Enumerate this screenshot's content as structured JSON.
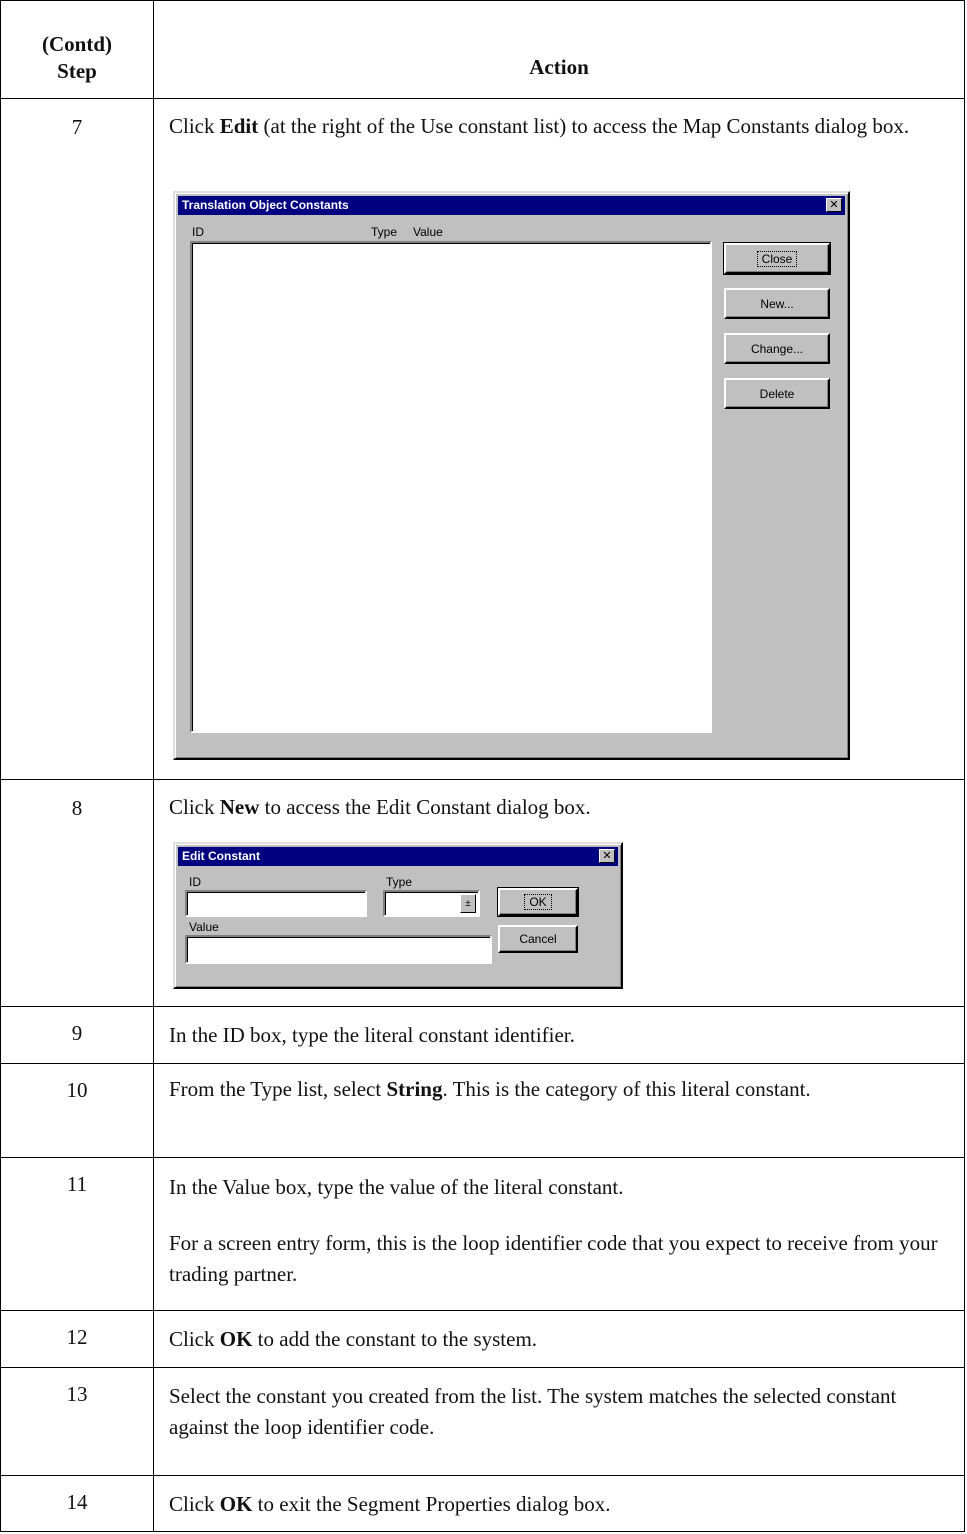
{
  "header": {
    "step_line1": "(Contd)",
    "step_line2": "Step",
    "action": "Action"
  },
  "steps": [
    {
      "num": "7",
      "pre": "Click ",
      "bold": "Edit",
      "post": " (at the right of the Use constant list) to access the Map Constants dialog box."
    },
    {
      "num": "8",
      "pre": "Click ",
      "bold": "New",
      "post": " to access the Edit Constant dialog box."
    },
    {
      "num": "9",
      "text": "In the ID box, type the literal constant identifier."
    },
    {
      "num": "10",
      "pre": "From the Type list, select ",
      "bold": "String",
      "post": ". This is the category of this literal constant."
    },
    {
      "num": "11",
      "text": "In the Value box, type the value of the literal constant.",
      "text2": "For a screen entry form, this is the loop identifier code that you expect to receive from your trading partner."
    },
    {
      "num": "12",
      "pre": "Click ",
      "bold": "OK",
      "post": " to add the constant to the system."
    },
    {
      "num": "13",
      "text": "Select the constant you created from the list. The system matches the selected constant against the loop identifier code."
    },
    {
      "num": "14",
      "pre": "Click ",
      "bold": "OK",
      "post": " to exit the Segment Properties dialog box."
    }
  ],
  "dialog_constants": {
    "title": "Translation Object Constants",
    "col_id": "ID",
    "col_type": "Type",
    "col_value": "Value",
    "buttons": {
      "close": "Close",
      "new": "New...",
      "change": "Change...",
      "delete": "Delete"
    }
  },
  "dialog_edit": {
    "title": "Edit Constant",
    "id_label": "ID",
    "type_label": "Type",
    "value_label": "Value",
    "id_value": "",
    "type_value": "",
    "value_value": "",
    "buttons": {
      "ok": "OK",
      "cancel": "Cancel"
    }
  }
}
